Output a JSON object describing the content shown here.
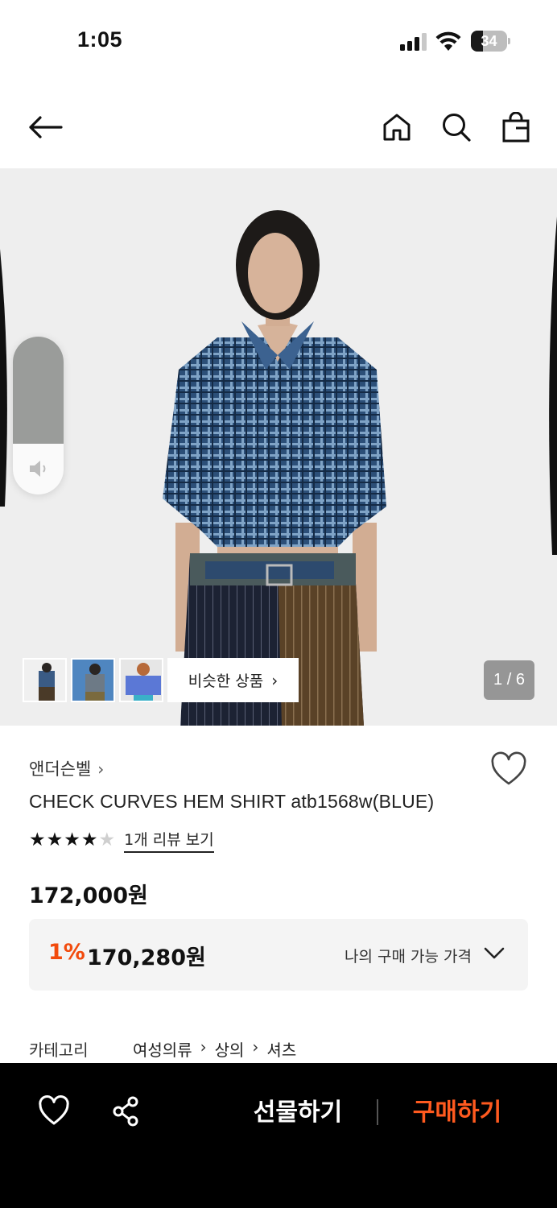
{
  "status_bar": {
    "time": "1:05",
    "battery": "34",
    "battery_level": 0.34,
    "signal_icon": "cellular-signal-icon",
    "wifi_icon": "wifi-icon"
  },
  "nav": {
    "back_icon": "arrow-left-icon",
    "home_icon": "home-icon",
    "search_icon": "search-icon",
    "bag_icon": "shopping-bag-icon"
  },
  "gallery": {
    "page_counter": "1 / 6",
    "similar_button": "비슷한 상품",
    "thumbnail_count": 3,
    "volume_level": 0.68
  },
  "product": {
    "brand": "앤더슨벨",
    "name": "CHECK CURVES HEM SHIRT atb1568w(BLUE)",
    "rating": 4,
    "rating_max": 5,
    "review_link": "1개 리뷰 보기",
    "price": "172,000원",
    "discount_rate": "1%",
    "discount_price": "170,280원",
    "my_price_label": "나의 구매 가능 가격"
  },
  "category": {
    "label": "카테고리",
    "path": [
      "여성의류",
      "상의",
      "셔츠"
    ]
  },
  "bottom_bar": {
    "gift_label": "선물하기",
    "buy_label": "구매하기",
    "wish_icon": "heart-icon",
    "share_icon": "share-icon"
  },
  "colors": {
    "accent": "#f24b0d",
    "buy": "#ff5a1f",
    "bottom_bar": "#000000"
  }
}
